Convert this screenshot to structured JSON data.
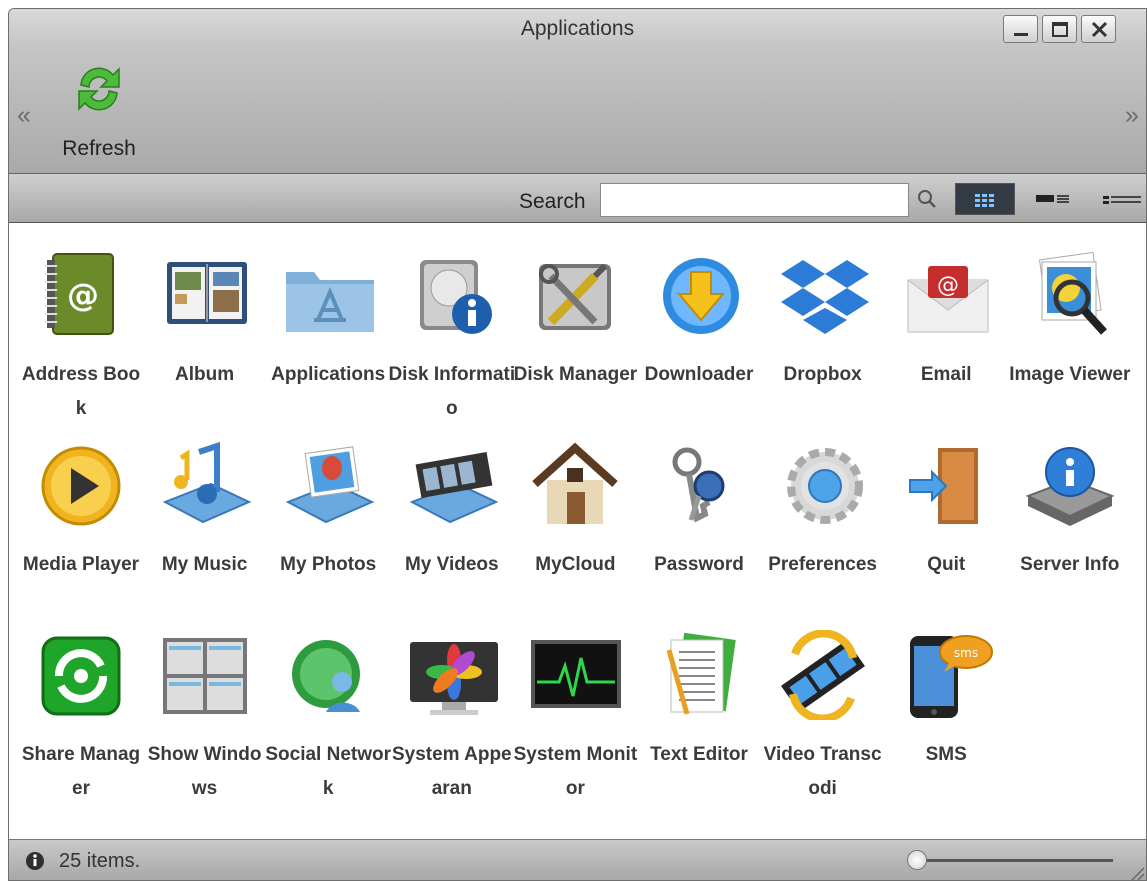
{
  "window": {
    "title": "Applications",
    "scroll_left": "«",
    "scroll_right": "»"
  },
  "toolbar": {
    "refresh_label": "Refresh",
    "search_label": "Search",
    "search_value": "",
    "view_modes": [
      "grid-view-icon",
      "detail-view-icon",
      "list-view-icon"
    ],
    "active_view": "grid"
  },
  "apps": [
    {
      "label": "Address Book",
      "icon": "address-book-icon"
    },
    {
      "label": "Album",
      "icon": "album-icon"
    },
    {
      "label": "Applications",
      "icon": "applications-folder-icon"
    },
    {
      "label": "Disk Informatio",
      "icon": "disk-information-icon"
    },
    {
      "label": "Disk Manager",
      "icon": "disk-manager-icon"
    },
    {
      "label": "Downloader",
      "icon": "downloader-icon"
    },
    {
      "label": "Dropbox",
      "icon": "dropbox-icon"
    },
    {
      "label": "Email",
      "icon": "email-icon"
    },
    {
      "label": "Image Viewer",
      "icon": "image-viewer-icon"
    },
    {
      "label": "Media Player",
      "icon": "media-player-icon"
    },
    {
      "label": "My Music",
      "icon": "my-music-icon"
    },
    {
      "label": "My Photos",
      "icon": "my-photos-icon"
    },
    {
      "label": "My Videos",
      "icon": "my-videos-icon"
    },
    {
      "label": "MyCloud",
      "icon": "mycloud-home-icon"
    },
    {
      "label": "Password",
      "icon": "password-keys-icon"
    },
    {
      "label": "Preferences",
      "icon": "preferences-gear-icon"
    },
    {
      "label": "Quit",
      "icon": "quit-door-icon"
    },
    {
      "label": "Server Info",
      "icon": "server-info-icon"
    },
    {
      "label": "Share Manager",
      "icon": "share-manager-icon"
    },
    {
      "label": "Show Windows",
      "icon": "show-windows-icon"
    },
    {
      "label": "Social Network",
      "icon": "social-network-icon"
    },
    {
      "label": "System Appearan",
      "icon": "system-appearance-icon"
    },
    {
      "label": "System Monitor",
      "icon": "system-monitor-icon"
    },
    {
      "label": "Text Editor",
      "icon": "text-editor-icon"
    },
    {
      "label": "Video Transcodi",
      "icon": "video-transcoding-icon"
    },
    {
      "label": "SMS",
      "icon": "sms-phone-icon",
      "badge": "sms"
    }
  ],
  "status": {
    "text": "25 items.",
    "zoom_level": 0
  },
  "colors": {
    "titlebar": "#b8b8b8",
    "toolbar": "#bdbdbd",
    "active_view": "#333b44",
    "label_text": "#3b3b3b"
  }
}
